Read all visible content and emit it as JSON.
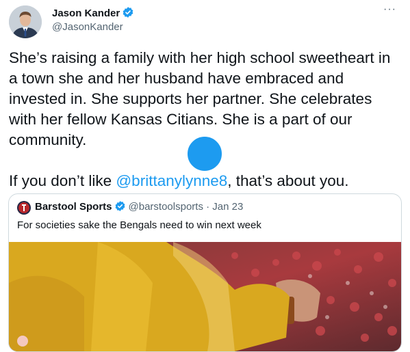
{
  "author": {
    "name": "Jason Kander",
    "handle": "@JasonKander"
  },
  "more_icon": "···",
  "tweet": {
    "paragraph1": "She’s raising a family with her high school sweetheart in a town she and her husband have embraced and invested in. She supports her partner. She celebrates with her fellow Kansas Citians. She is a part of our community.",
    "p2_before": "If you don’t like ",
    "p2_mention": "@brittanylynne8",
    "p2_after": ", that’s about you."
  },
  "quote": {
    "name": "Barstool Sports",
    "handle_date": "@barstoolsports · Jan 23",
    "text": "For societies sake the Bengals need to win next week"
  },
  "colors": {
    "accent": "#1d9bf0",
    "text": "#0f1419",
    "secondary": "#536471",
    "border": "#cfd9de"
  },
  "icons": {
    "verified": "verified-badge-icon",
    "more": "more-options-icon",
    "play": "play-icon"
  }
}
